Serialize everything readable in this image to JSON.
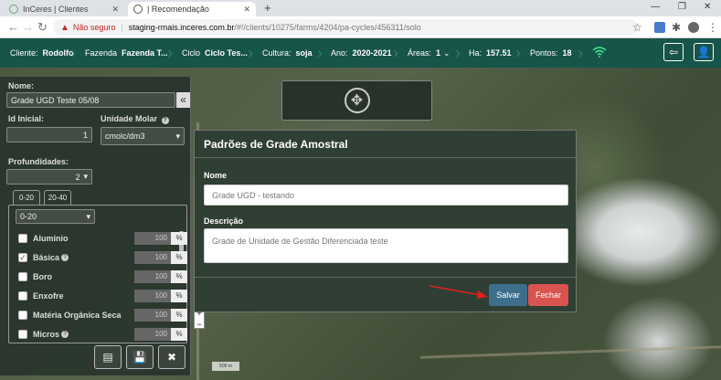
{
  "browser": {
    "tabs": [
      {
        "title": "InCeres | Clientes"
      },
      {
        "title": "| Recomendação"
      }
    ],
    "new_tab": "+",
    "address": {
      "security_label": "Não seguro",
      "host": "staging-rmais.inceres.com.br",
      "path": "/#!/clients/10275/farms/4204/pa-cycles/456311/solo"
    }
  },
  "header": {
    "items": [
      {
        "label": "Cliente:",
        "value": "Rodolfo"
      },
      {
        "label": "Fazenda",
        "value": "Fazenda T..."
      },
      {
        "label": "Ciclo",
        "value": "Ciclo Tes..."
      },
      {
        "label": "Cultura:",
        "value": "soja"
      },
      {
        "label": "Ano:",
        "value": "2020-2021"
      },
      {
        "label": "Áreas:",
        "value": "1"
      },
      {
        "label": "Ha:",
        "value": "157.51"
      },
      {
        "label": "Pontos:",
        "value": "18"
      }
    ],
    "colors": {
      "bg": "#17544a",
      "wifi": "#3ddc84"
    }
  },
  "panel": {
    "nome_label": "Nome:",
    "nome_value": "Grade UGD Teste 05/08",
    "id_inicial_label": "Id Inicial:",
    "id_inicial_value": "1",
    "unidade_label": "Unidade Molar",
    "unidade_value": "cmolc/dm3",
    "profundidades_label": "Profundidades:",
    "profundidades_value": "2",
    "depth_tabs": [
      "0-20",
      "20-40"
    ],
    "depth_select": "0-20",
    "rows": [
      {
        "label": "Alumínio",
        "checked": false,
        "help": false,
        "value": "100",
        "unit": "%"
      },
      {
        "label": "Básica",
        "checked": true,
        "help": true,
        "value": "100",
        "unit": "%"
      },
      {
        "label": "Boro",
        "checked": false,
        "help": false,
        "value": "100",
        "unit": "%"
      },
      {
        "label": "Enxofre",
        "checked": false,
        "help": false,
        "value": "100",
        "unit": "%"
      },
      {
        "label": "Matéria Orgânica Seca",
        "checked": false,
        "help": false,
        "value": "100",
        "unit": "%"
      },
      {
        "label": "Micros",
        "checked": false,
        "help": true,
        "value": "100",
        "unit": "%"
      }
    ]
  },
  "map": {
    "scale_label": "500 m"
  },
  "modal": {
    "title": "Padrões de Grade Amostral",
    "nome_label": "Nome",
    "nome_placeholder": "Grade UGD - testando",
    "descricao_label": "Descrição",
    "descricao_placeholder": "Grade de Unidade de Gestão Diferenciada teste",
    "save_label": "Salvar",
    "close_label": "Fechar",
    "colors": {
      "save": "#3d6e8c",
      "close": "#d9534f",
      "arrow": "#e02020"
    }
  }
}
